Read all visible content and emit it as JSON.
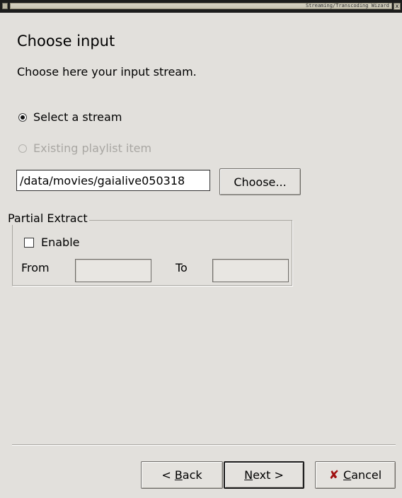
{
  "window": {
    "title": "Streaming/Transcoding Wizard",
    "close_glyph": "x"
  },
  "page": {
    "heading": "Choose input",
    "subheading": "Choose here your input stream."
  },
  "input_source": {
    "select_stream_label": "Select a stream",
    "select_stream_checked": true,
    "playlist_item_label": "Existing playlist item",
    "playlist_item_enabled": false,
    "path_value": "/data/movies/gaialive050318",
    "choose_button_label": "Choose..."
  },
  "partial_extract": {
    "group_label": "Partial Extract",
    "enable_label": "Enable",
    "enable_checked": false,
    "from_label": "From",
    "from_value": "",
    "to_label": "To",
    "to_value": ""
  },
  "footer": {
    "back": {
      "prefix": "< ",
      "mnemonic": "B",
      "rest": "ack"
    },
    "next": {
      "mnemonic": "N",
      "rest": "ext >"
    },
    "cancel": {
      "mnemonic": "C",
      "rest": "ancel",
      "icon": "cancel-x-icon",
      "icon_glyph": "✘"
    }
  }
}
